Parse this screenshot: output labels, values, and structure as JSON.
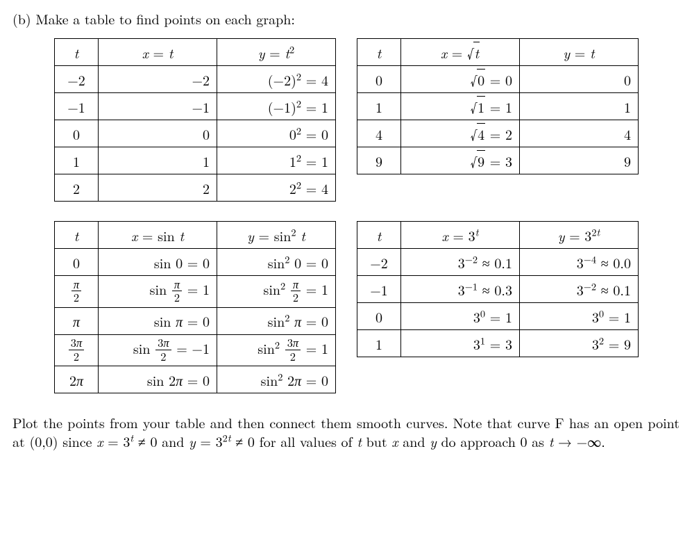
{
  "intro_label": "(b)",
  "intro_text": "Make a table to find points on each graph:",
  "table1": {
    "hdr_t": "t",
    "hdr_x": "x = t",
    "hdr_y": "y = t²",
    "rows": [
      {
        "t": "−2",
        "x": "−2",
        "y": "(−2)² = 4"
      },
      {
        "t": "−1",
        "x": "−1",
        "y": "(−1)² = 1"
      },
      {
        "t": "0",
        "x": "0",
        "y": "0² = 0"
      },
      {
        "t": "1",
        "x": "1",
        "y": "1² = 1"
      },
      {
        "t": "2",
        "x": "2",
        "y": "2² = 4"
      }
    ]
  },
  "table2": {
    "hdr_t": "t",
    "hdr_x": "x = √t",
    "hdr_y": "y = t",
    "rows": [
      {
        "t": "0",
        "x": "√0 = 0",
        "y": "0"
      },
      {
        "t": "1",
        "x": "√1 = 1",
        "y": "1"
      },
      {
        "t": "4",
        "x": "√4 = 2",
        "y": "4"
      },
      {
        "t": "9",
        "x": "√9 = 3",
        "y": "9"
      }
    ]
  },
  "table3": {
    "hdr_t": "t",
    "hdr_x": "x = sin t",
    "hdr_y": "y = sin² t",
    "rows": [
      {
        "t": "0",
        "x": "sin 0 = 0",
        "y": "sin² 0 = 0"
      },
      {
        "t": "π/2",
        "x": "sin π/2 = 1",
        "y": "sin² π/2 = 1"
      },
      {
        "t": "π",
        "x": "sin π = 0",
        "y": "sin² π = 0"
      },
      {
        "t": "3π/2",
        "x": "sin 3π/2 = −1",
        "y": "sin² 3π/2 = 1"
      },
      {
        "t": "2π",
        "x": "sin 2π = 0",
        "y": "sin² 2π = 0"
      }
    ]
  },
  "table4": {
    "hdr_t": "t",
    "hdr_x": "x = 3ᵗ",
    "hdr_y": "y = 3²ᵗ",
    "rows": [
      {
        "t": "−2",
        "x": "3⁻² ≈ 0.1",
        "y": "3⁻⁴ ≈ 0.0"
      },
      {
        "t": "−1",
        "x": "3⁻¹ ≈ 0.3",
        "y": "3⁻² ≈ 0.1"
      },
      {
        "t": "0",
        "x": "3⁰ = 1",
        "y": "3⁰ = 1"
      },
      {
        "t": "1",
        "x": "3¹ = 3",
        "y": "3² = 9"
      }
    ]
  },
  "outro_text": "Plot the points from your table and then connect them smooth curves. Note that curve F has an open point at (0,0) since x = 3ᵗ ≠ 0 and y = 3²ᵗ ≠ 0 for all values of t but x and y do approach 0 as t → −∞.",
  "math": {
    "pi": "π",
    "neq": "≠",
    "approx": "≈",
    "to": "→",
    "minf": "−∞"
  }
}
